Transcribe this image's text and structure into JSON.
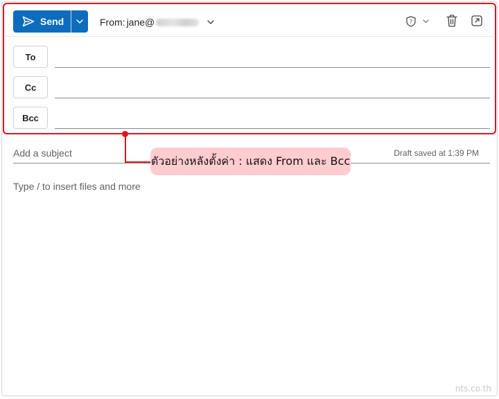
{
  "toolbar": {
    "send_label": "Send",
    "from_label": "From:",
    "from_address": "jane@",
    "icons": [
      "send-icon",
      "chevron-down-icon",
      "shield-icon",
      "trash-icon",
      "popout-icon"
    ]
  },
  "recipients": {
    "to_label": "To",
    "cc_label": "Cc",
    "bcc_label": "Bcc"
  },
  "subject": {
    "placeholder": "Add a subject",
    "draft_status": "Draft saved at 1:39 PM"
  },
  "body": {
    "placeholder": "Type / to insert files and more"
  },
  "annotation": {
    "text": "ตัวอย่างหลังตั้งค่า : แสดง From และ Bcc"
  },
  "watermark": "nts.co.th",
  "colors": {
    "accent": "#0f6cbd",
    "highlight": "#e0141e",
    "callout_bg": "#ffcccf"
  }
}
